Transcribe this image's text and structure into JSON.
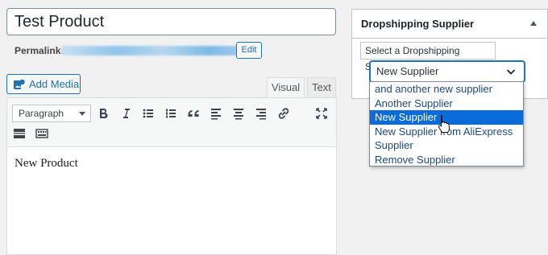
{
  "post": {
    "title": "Test Product",
    "permalink_label": "Permalink:",
    "edit_label": "Edit"
  },
  "media": {
    "add_media_label": "Add Media"
  },
  "editor_tabs": {
    "visual": "Visual",
    "text": "Text"
  },
  "toolbar": {
    "format_value": "Paragraph",
    "buttons": [
      "bold-icon",
      "italic-icon",
      "bulleted-list-icon",
      "numbered-list-icon",
      "blockquote-icon",
      "align-left-icon",
      "align-center-icon",
      "align-right-icon",
      "link-icon",
      "fullscreen-icon",
      "read-more-icon",
      "toolbar-toggle-icon"
    ]
  },
  "content": {
    "body_text": "New Product"
  },
  "supplier_box": {
    "title": "Dropshipping Supplier",
    "select_label": "Select a Dropshipping Supplier",
    "selected_value": "New Supplier",
    "options": [
      "and another new supplier",
      "Another Supplier",
      "New Supplier",
      "New Supplier from AliExpress",
      "Supplier",
      "Remove Supplier"
    ],
    "highlighted_index": 2
  },
  "colors": {
    "accent": "#2271b1",
    "highlight": "#0a6cd8",
    "background": "#f1f1f1"
  }
}
